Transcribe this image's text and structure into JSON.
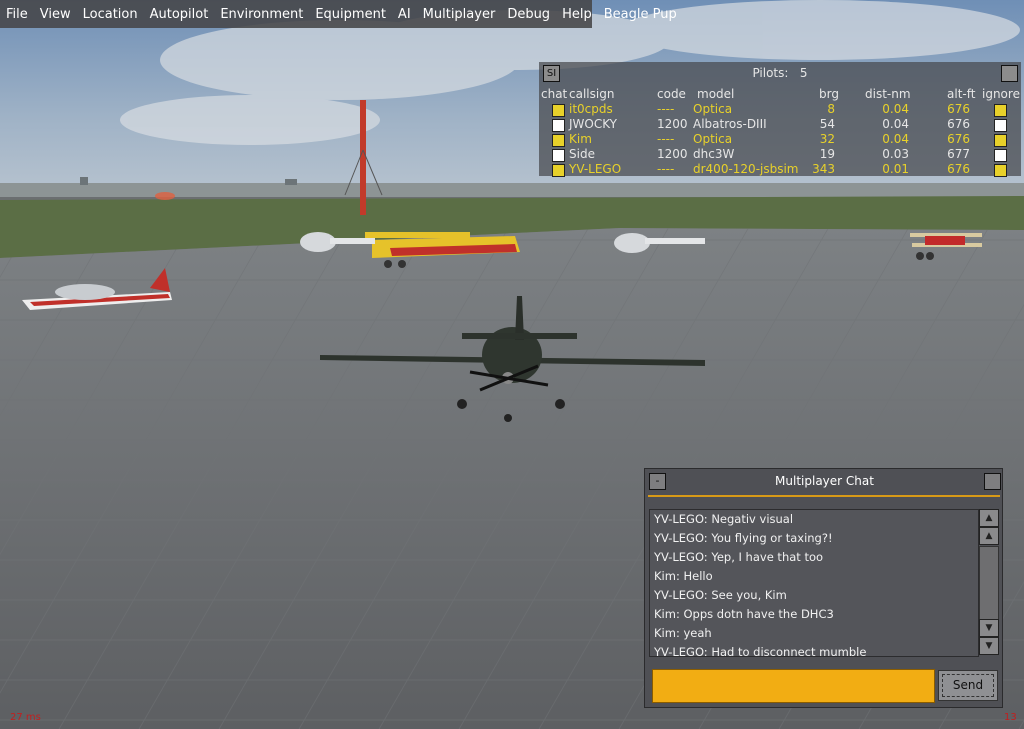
{
  "menu": [
    "File",
    "View",
    "Location",
    "Autopilot",
    "Environment",
    "Equipment",
    "AI",
    "Multiplayer",
    "Debug",
    "Help",
    "Beagle Pup"
  ],
  "pilot_list": {
    "left_button": "SI",
    "title": "Pilots:",
    "count": "5",
    "columns": {
      "chat": "chat",
      "callsign": "callsign",
      "code": "code",
      "model": "model",
      "brg": "brg",
      "dist": "dist-nm",
      "alt": "alt-ft",
      "ignore": "ignore"
    },
    "rows": [
      {
        "callsign": "it0cpds",
        "code": "----",
        "model": "Optica",
        "brg": "8",
        "dist": "0.04",
        "alt": "676",
        "highlight": true,
        "box_color": "#e8d12a"
      },
      {
        "callsign": "JWOCKY",
        "code": "1200",
        "model": "Albatros-DIII",
        "brg": "54",
        "dist": "0.04",
        "alt": "676",
        "highlight": false,
        "box_color": "#ffffff"
      },
      {
        "callsign": "Kim",
        "code": "----",
        "model": "Optica",
        "brg": "32",
        "dist": "0.04",
        "alt": "676",
        "highlight": true,
        "box_color": "#e8d12a"
      },
      {
        "callsign": "Side",
        "code": "1200",
        "model": "dhc3W",
        "brg": "19",
        "dist": "0.03",
        "alt": "677",
        "highlight": false,
        "box_color": "#ffffff"
      },
      {
        "callsign": "YV-LEGO",
        "code": "----",
        "model": "dr400-120-jsbsim",
        "brg": "343",
        "dist": "0.01",
        "alt": "676",
        "highlight": true,
        "box_color": "#e8d12a"
      }
    ]
  },
  "chat": {
    "title": "Multiplayer Chat",
    "minimize": "-",
    "messages": [
      "YV-LEGO: Negativ visual",
      "YV-LEGO: You flying or taxing?!",
      "YV-LEGO: Yep, I have that too",
      "Kim: Hello",
      "YV-LEGO: See you, Kim",
      "Kim: Opps dotn have the DHC3",
      "Kim: yeah",
      "YV-LEGO: Had to disconnect mumble"
    ],
    "input_value": "",
    "send_label": "Send"
  },
  "status": {
    "frame_time": "27 ms",
    "fps": "13"
  },
  "icons": {
    "scroll_top": "double-up-arrow",
    "scroll_up": "up-arrow",
    "scroll_down": "down-arrow",
    "scroll_bottom": "double-down-arrow"
  },
  "colors": {
    "accent": "#f2ad13",
    "highlight_text": "#e8d12a",
    "chat_bg": "#4f5055"
  }
}
